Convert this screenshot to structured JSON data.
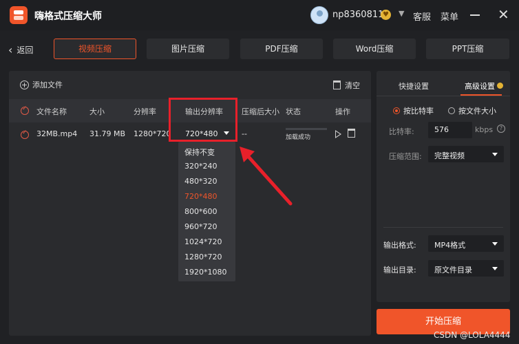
{
  "app": {
    "title": "嗨格式压缩大师",
    "username": "np8360811",
    "service": "客服",
    "menu": "菜单"
  },
  "nav": {
    "back": "返回",
    "tabs": [
      {
        "label": "视频压缩",
        "active": true
      },
      {
        "label": "图片压缩"
      },
      {
        "label": "PDF压缩"
      },
      {
        "label": "Word压缩"
      },
      {
        "label": "PPT压缩"
      }
    ]
  },
  "toolbar": {
    "add_file": "添加文件",
    "clear": "清空"
  },
  "table": {
    "headers": [
      "文件名称",
      "大小",
      "分辨率",
      "输出分辨率",
      "压缩后大小",
      "状态",
      "操作"
    ],
    "row": {
      "filename": "32MB.mp4",
      "size": "31.79 MB",
      "resolution": "1280*720",
      "output_resolution": "720*480",
      "compressed_size": "--",
      "status": "加载成功",
      "progress": 0.0
    }
  },
  "resolution_dropdown": {
    "options": [
      "保持不变",
      "320*240",
      "480*320",
      "720*480",
      "800*600",
      "960*720",
      "1024*720",
      "1280*720",
      "1920*1080"
    ],
    "selected": "720*480"
  },
  "settings": {
    "tabs": [
      "快捷设置",
      "高级设置"
    ],
    "active_tab": "高级设置",
    "mode_options": [
      "按比特率",
      "按文件大小"
    ],
    "mode_selected": "按比特率",
    "bitrate_label": "比特率:",
    "bitrate_value": "576",
    "bitrate_unit": "kbps",
    "help": "?",
    "range_label": "压缩范围:",
    "range_value": "完整视频",
    "format_label": "输出格式:",
    "format_value": "MP4格式",
    "dir_label": "输出目录:",
    "dir_value": "原文件目录"
  },
  "start_button": "开始压缩",
  "watermark": "CSDN @LOLA4444",
  "colors": {
    "accent": "#f0552a",
    "highlight": "#e8202a",
    "bg": "#202124",
    "panel": "#2a2b2e"
  }
}
